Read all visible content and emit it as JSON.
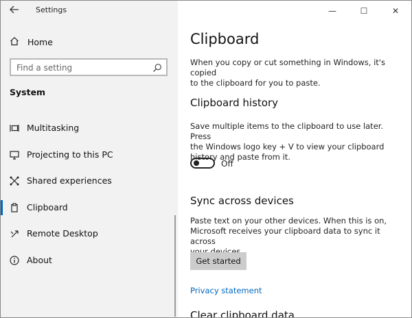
{
  "window": {
    "title": "Settings",
    "controls": {
      "minimize": "—",
      "maximize": "☐",
      "close": "✕"
    }
  },
  "sidebar": {
    "home_label": "Home",
    "search_placeholder": "Find a setting",
    "section_title": "System",
    "items": [
      {
        "label": "Multitasking",
        "icon": "multitasking-icon"
      },
      {
        "label": "Projecting to this PC",
        "icon": "projecting-icon"
      },
      {
        "label": "Shared experiences",
        "icon": "shared-experiences-icon"
      },
      {
        "label": "Clipboard",
        "icon": "clipboard-icon",
        "active": true
      },
      {
        "label": "Remote Desktop",
        "icon": "remote-desktop-icon"
      },
      {
        "label": "About",
        "icon": "info-icon"
      }
    ]
  },
  "content": {
    "page_title": "Clipboard",
    "intro_line1": "When you copy or cut something in Windows, it's copied",
    "intro_line2": "to the clipboard for you to paste.",
    "history": {
      "title": "Clipboard history",
      "line1": "Save multiple items to the clipboard to use later. Press",
      "line2": "the Windows logo key + V to view your clipboard",
      "line3": "history and paste from it.",
      "toggle_state": "Off"
    },
    "sync": {
      "title": "Sync across devices",
      "line1": "Paste text on your other devices. When this is on,",
      "line2": "Microsoft receives your clipboard data to sync it across",
      "line3": "your devices.",
      "button_label": "Get started"
    },
    "privacy_link": "Privacy statement",
    "clear_title": "Clear clipboard data"
  },
  "colors": {
    "accent": "#0067c0",
    "sidebar_bg": "#f2f2f2",
    "button_bg": "#cccccc"
  }
}
